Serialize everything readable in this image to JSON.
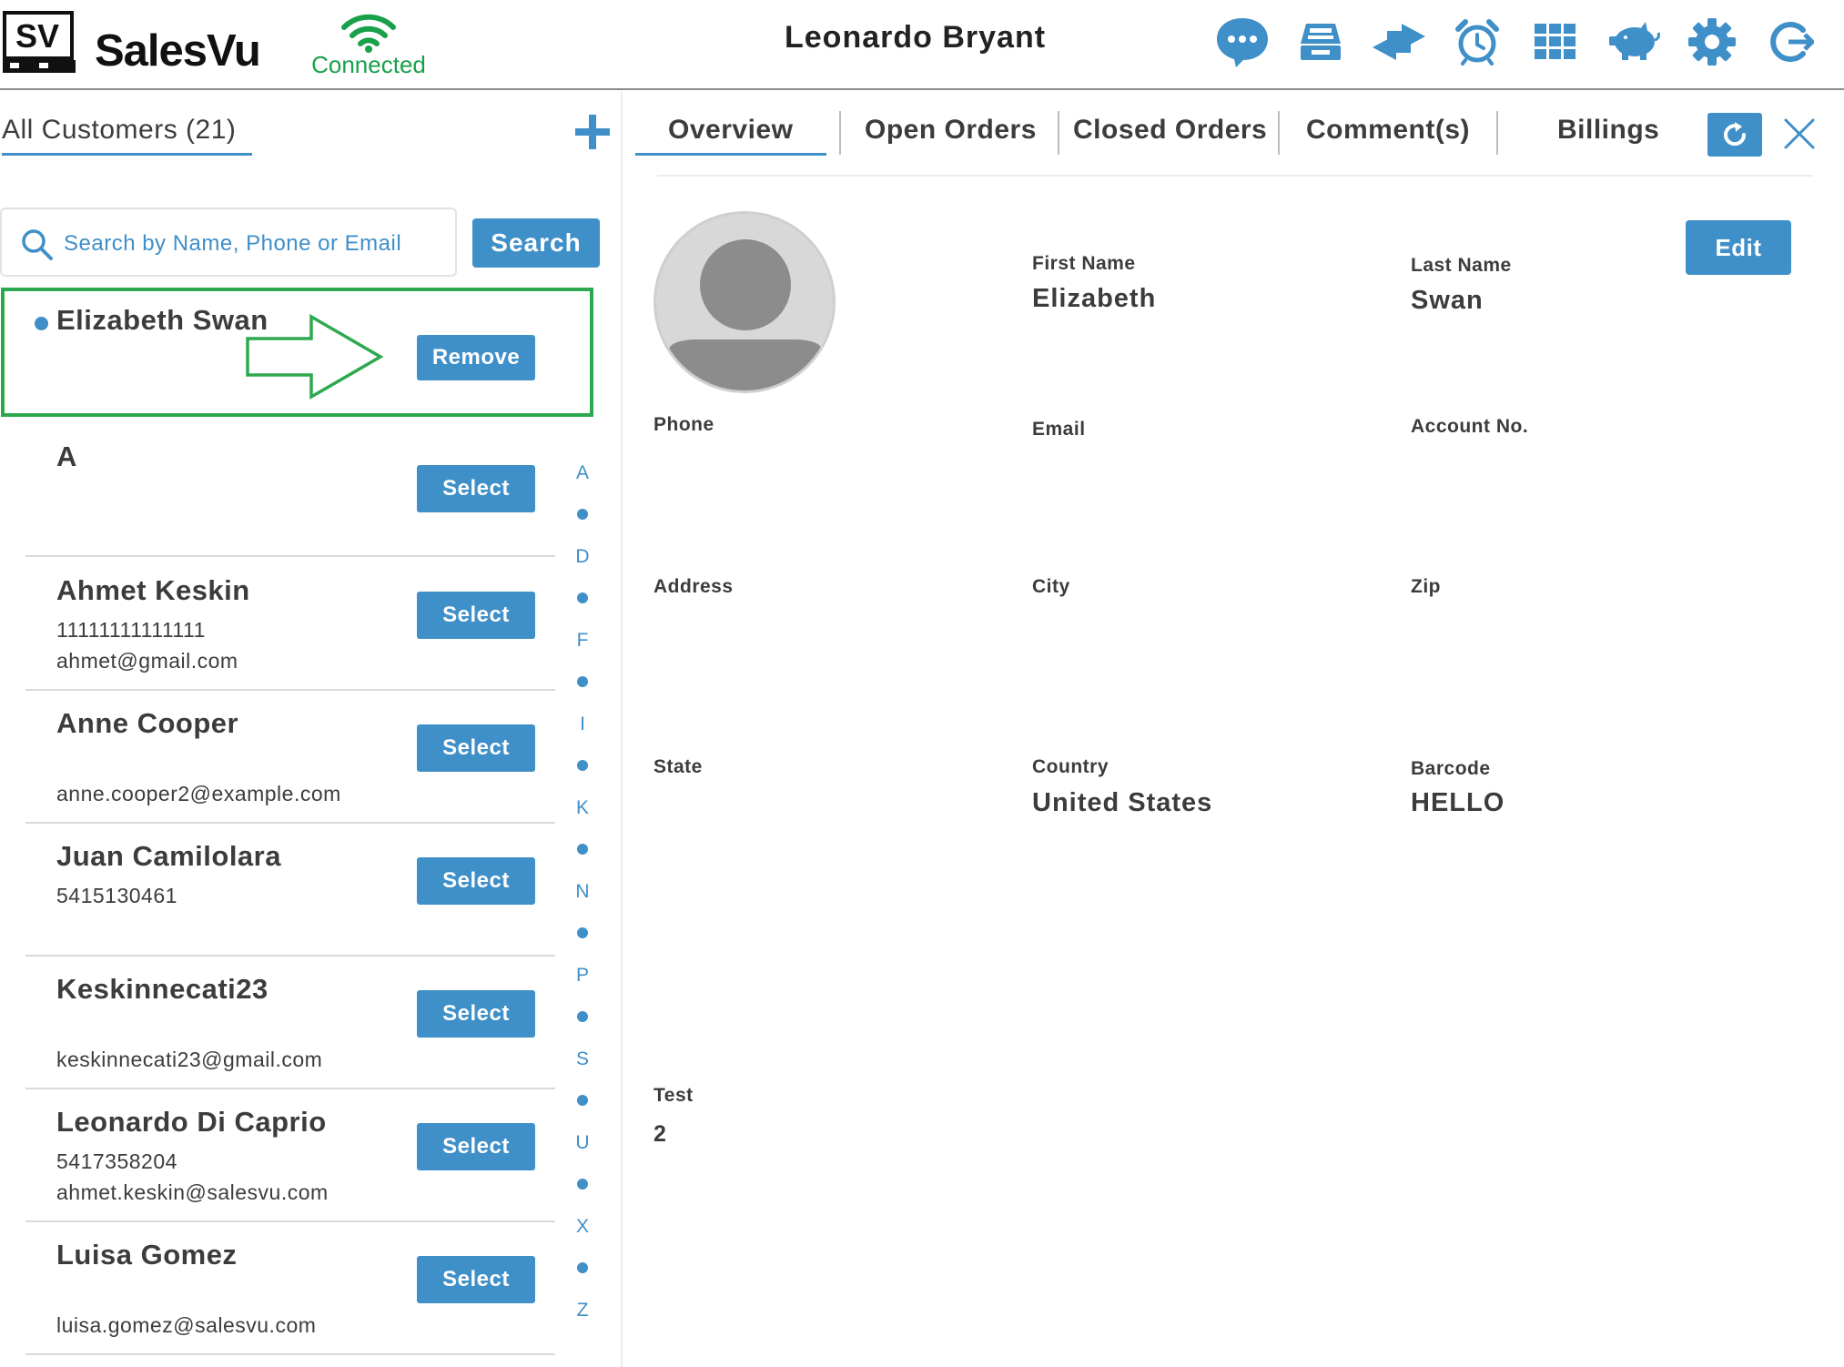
{
  "header": {
    "logo_text": "SV",
    "brand": "SalesVu",
    "connection_status": "Connected",
    "user_name": "Leonardo Bryant",
    "icons": [
      "chat-icon",
      "register-icon",
      "transfer-icon",
      "alarm-icon",
      "grid-icon",
      "piggy-bank-icon",
      "settings-icon",
      "logout-icon"
    ]
  },
  "customers": {
    "title": "All Customers (21)",
    "search_placeholder": "Search by Name, Phone or Email",
    "search_label": "Search",
    "selected": {
      "name": "Elizabeth Swan",
      "button": "Remove"
    },
    "select_label": "Select",
    "list": [
      {
        "name": "A",
        "phone": "",
        "email": ""
      },
      {
        "name": "Ahmet Keskin",
        "phone": "11111111111111",
        "email": "ahmet@gmail.com"
      },
      {
        "name": "Anne Cooper",
        "phone": "",
        "email": "anne.cooper2@example.com"
      },
      {
        "name": "Juan Camilolara",
        "phone": "5415130461",
        "email": ""
      },
      {
        "name": "Keskinnecati23",
        "phone": "",
        "email": "keskinnecati23@gmail.com"
      },
      {
        "name": "Leonardo Di Caprio",
        "phone": "5417358204",
        "email": "ahmet.keskin@salesvu.com"
      },
      {
        "name": "Luisa Gomez",
        "phone": "",
        "email": "luisa.gomez@salesvu.com"
      }
    ],
    "alphabet": [
      "A",
      "D",
      "F",
      "I",
      "K",
      "N",
      "P",
      "S",
      "U",
      "X",
      "Z"
    ]
  },
  "tabs": [
    "Overview",
    "Open Orders",
    "Closed Orders",
    "Comment(s)",
    "Billings"
  ],
  "detail": {
    "edit_label": "Edit",
    "fields": {
      "first_name": {
        "label": "First Name",
        "value": "Elizabeth"
      },
      "last_name": {
        "label": "Last Name",
        "value": "Swan"
      },
      "phone": {
        "label": "Phone",
        "value": ""
      },
      "email": {
        "label": "Email",
        "value": ""
      },
      "account_no": {
        "label": "Account No.",
        "value": ""
      },
      "address": {
        "label": "Address",
        "value": ""
      },
      "city": {
        "label": "City",
        "value": ""
      },
      "zip": {
        "label": "Zip",
        "value": ""
      },
      "state": {
        "label": "State",
        "value": ""
      },
      "country": {
        "label": "Country",
        "value": "United States"
      },
      "barcode": {
        "label": "Barcode",
        "value": "HELLO"
      },
      "test": {
        "label": "Test",
        "value": "2"
      }
    }
  },
  "colors": {
    "accent": "#3f8fc8",
    "connected": "#19a04b",
    "highlight_border": "#2ea84f"
  }
}
